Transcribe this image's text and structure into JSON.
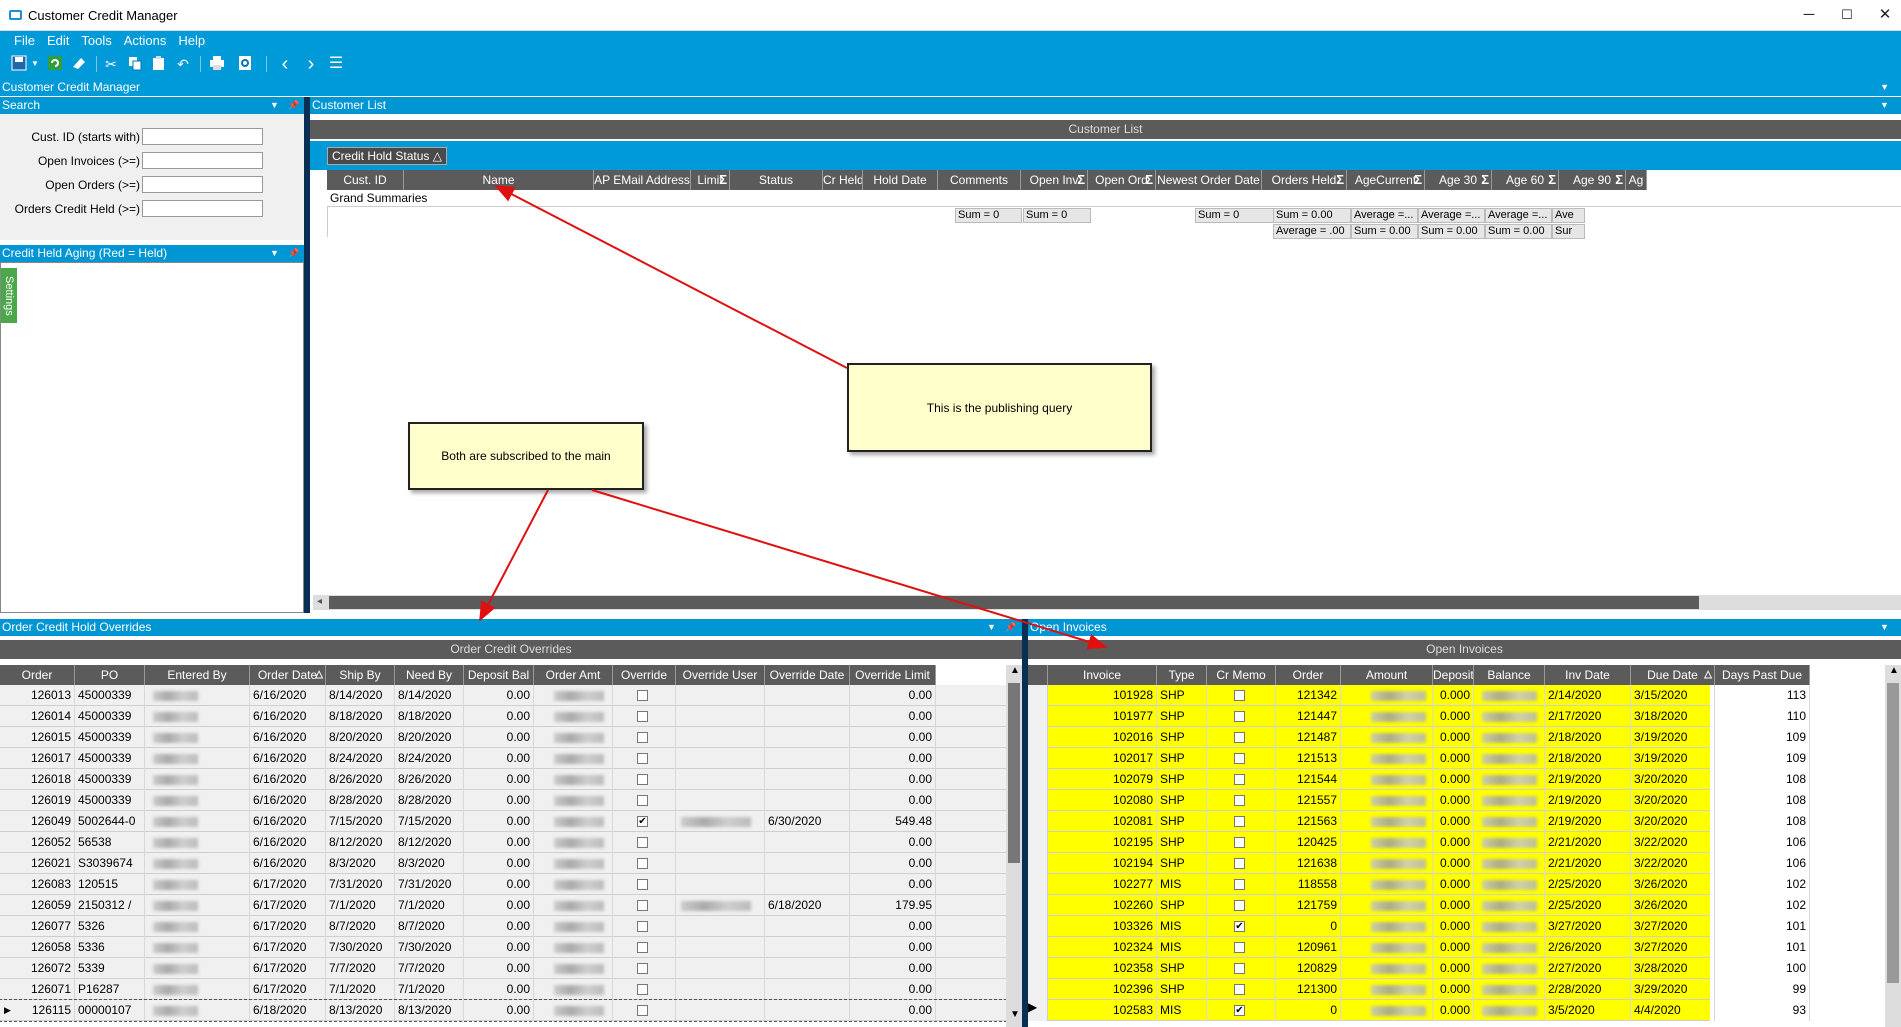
{
  "window": {
    "title": "Customer Credit Manager",
    "min": "─",
    "max": "☐",
    "close": "✕"
  },
  "menu": [
    "File",
    "Edit",
    "Tools",
    "Actions",
    "Help"
  ],
  "toolbar_icons": [
    "save-icon",
    "refresh-icon",
    "clear-icon",
    "cut-icon",
    "copy-icon",
    "paste-icon",
    "undo-icon",
    "print-icon",
    "print-preview-icon",
    "back-icon",
    "forward-icon",
    "menu-icon"
  ],
  "form_title": "Customer Credit Manager",
  "search": {
    "title": "Search",
    "fields": [
      {
        "label": "Cust. ID (starts with)",
        "value": ""
      },
      {
        "label": "Open Invoices (>=)",
        "value": ""
      },
      {
        "label": "Open Orders (>=)",
        "value": ""
      },
      {
        "label": "Orders Credit Held (>=)",
        "value": ""
      }
    ]
  },
  "aging": {
    "title": "Credit Held Aging (Red = Held)",
    "settings_tab": "Settings"
  },
  "customer_list": {
    "title": "Customer List",
    "grid_title": "Customer List",
    "group_tag": "Credit Hold Status",
    "columns": [
      "Cust. ID",
      "Name",
      "AP EMail Address",
      "Limit",
      "Status",
      "Cr Held",
      "Hold Date",
      "Comments",
      "Open Inv",
      "Open Ord",
      "Newest Order Date",
      "Orders Held",
      "AgeCurrent",
      "Age 30",
      "Age 60",
      "Age 90",
      "Ag"
    ],
    "grand_summaries": "Grand Summaries",
    "sum1": [
      "Sum = 0",
      "Sum = 0",
      "Sum = 0",
      "Sum = 0.00",
      "Average =...",
      "Average =...",
      "Average =...",
      "Ave"
    ],
    "sum2": [
      "Average = .00",
      "Sum = 0.00",
      "Sum = 0.00",
      "Sum = 0.00",
      "Sur"
    ]
  },
  "callouts": {
    "publishing": "This is the publishing query",
    "subscribed": "Both are subscribed to the main"
  },
  "order_overrides": {
    "title": "Order Credit Hold Overrides",
    "grid_title": "Order Credit Overrides",
    "columns": [
      "Order",
      "PO",
      "Entered By",
      "Order Date",
      "Ship By",
      "Need By",
      "Deposit Bal",
      "Order Amt",
      "Override",
      "Override User",
      "Override Date",
      "Override Limit"
    ],
    "rows": [
      [
        "126013",
        "45000339",
        "6/16/2020",
        "8/14/2020",
        "8/14/2020",
        "0.00",
        false,
        "",
        "0.00"
      ],
      [
        "126014",
        "45000339",
        "6/16/2020",
        "8/18/2020",
        "8/18/2020",
        "0.00",
        false,
        "",
        "0.00"
      ],
      [
        "126015",
        "45000339",
        "6/16/2020",
        "8/20/2020",
        "8/20/2020",
        "0.00",
        false,
        "",
        "0.00"
      ],
      [
        "126017",
        "45000339",
        "6/16/2020",
        "8/24/2020",
        "8/24/2020",
        "0.00",
        false,
        "",
        "0.00"
      ],
      [
        "126018",
        "45000339",
        "6/16/2020",
        "8/26/2020",
        "8/26/2020",
        "0.00",
        false,
        "",
        "0.00"
      ],
      [
        "126019",
        "45000339",
        "6/16/2020",
        "8/28/2020",
        "8/28/2020",
        "0.00",
        false,
        "",
        "0.00"
      ],
      [
        "126049",
        "5002644-0",
        "6/16/2020",
        "7/15/2020",
        "7/15/2020",
        "0.00",
        true,
        "6/30/2020",
        "549.48"
      ],
      [
        "126052",
        "56538",
        "6/16/2020",
        "8/12/2020",
        "8/12/2020",
        "0.00",
        false,
        "",
        "0.00"
      ],
      [
        "126021",
        "S3039674",
        "6/16/2020",
        "8/3/2020",
        "8/3/2020",
        "0.00",
        false,
        "",
        "0.00"
      ],
      [
        "126083",
        "120515",
        "6/17/2020",
        "7/31/2020",
        "7/31/2020",
        "0.00",
        false,
        "",
        "0.00"
      ],
      [
        "126059",
        "2150312 /",
        "6/17/2020",
        "7/1/2020",
        "7/1/2020",
        "0.00",
        false,
        "6/18/2020",
        "179.95"
      ],
      [
        "126077",
        "5326",
        "6/17/2020",
        "8/7/2020",
        "8/7/2020",
        "0.00",
        false,
        "",
        "0.00"
      ],
      [
        "126058",
        "5336",
        "6/17/2020",
        "7/30/2020",
        "7/30/2020",
        "0.00",
        false,
        "",
        "0.00"
      ],
      [
        "126072",
        "5339",
        "6/17/2020",
        "7/7/2020",
        "7/7/2020",
        "0.00",
        false,
        "",
        "0.00"
      ],
      [
        "126071",
        "P16287",
        "6/17/2020",
        "7/1/2020",
        "7/1/2020",
        "0.00",
        false,
        "",
        "0.00"
      ],
      [
        "126115",
        "00000107",
        "6/18/2020",
        "8/13/2020",
        "8/13/2020",
        "0.00",
        false,
        "",
        "0.00"
      ]
    ]
  },
  "open_invoices": {
    "title": "Open Invoices",
    "grid_title": "Open Invoices",
    "columns": [
      "Invoice",
      "Type",
      "Cr Memo",
      "Order",
      "Amount",
      "Deposit",
      "Balance",
      "Inv Date",
      "Due Date",
      "Days Past Due"
    ],
    "rows": [
      [
        "101928",
        "SHP",
        false,
        "121342",
        "0.000",
        "2/14/2020",
        "3/15/2020",
        "113"
      ],
      [
        "101977",
        "SHP",
        false,
        "121447",
        "0.000",
        "2/17/2020",
        "3/18/2020",
        "110"
      ],
      [
        "102016",
        "SHP",
        false,
        "121487",
        "0.000",
        "2/18/2020",
        "3/19/2020",
        "109"
      ],
      [
        "102017",
        "SHP",
        false,
        "121513",
        "0.000",
        "2/18/2020",
        "3/19/2020",
        "109"
      ],
      [
        "102079",
        "SHP",
        false,
        "121544",
        "0.000",
        "2/19/2020",
        "3/20/2020",
        "108"
      ],
      [
        "102080",
        "SHP",
        false,
        "121557",
        "0.000",
        "2/19/2020",
        "3/20/2020",
        "108"
      ],
      [
        "102081",
        "SHP",
        false,
        "121563",
        "0.000",
        "2/19/2020",
        "3/20/2020",
        "108"
      ],
      [
        "102195",
        "SHP",
        false,
        "120425",
        "0.000",
        "2/21/2020",
        "3/22/2020",
        "106"
      ],
      [
        "102194",
        "SHP",
        false,
        "121638",
        "0.000",
        "2/21/2020",
        "3/22/2020",
        "106"
      ],
      [
        "102277",
        "MIS",
        false,
        "118558",
        "0.000",
        "2/25/2020",
        "3/26/2020",
        "102"
      ],
      [
        "102260",
        "SHP",
        false,
        "121759",
        "0.000",
        "2/25/2020",
        "3/26/2020",
        "102"
      ],
      [
        "103326",
        "MIS",
        true,
        "0",
        "0.000",
        "3/27/2020",
        "3/27/2020",
        "101"
      ],
      [
        "102324",
        "MIS",
        false,
        "120961",
        "0.000",
        "2/26/2020",
        "3/27/2020",
        "101"
      ],
      [
        "102358",
        "SHP",
        false,
        "120829",
        "0.000",
        "2/27/2020",
        "3/28/2020",
        "100"
      ],
      [
        "102396",
        "SHP",
        false,
        "121300",
        "0.000",
        "2/28/2020",
        "3/29/2020",
        "99"
      ],
      [
        "102583",
        "MIS",
        true,
        "0",
        "0.000",
        "3/5/2020",
        "4/4/2020",
        "93"
      ]
    ]
  },
  "colors": {
    "accent": "#009ad8",
    "header_gray": "#5b5b5b",
    "highlight_yellow": "#ffff00",
    "arrow_red": "#e01010"
  }
}
